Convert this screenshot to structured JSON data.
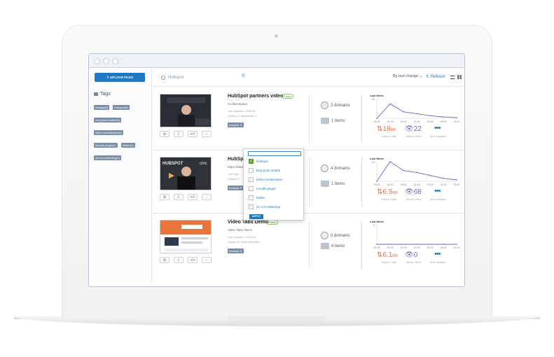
{
  "sidebar": {
    "upload_label": "⇧ UPLOAD FILES",
    "tags_title": "Tags",
    "tags": [
      "metags(0)",
      "hubspot(4)",
      "blog post content(1)",
      "video monetization(1)",
      "moodle plugin(1)",
      "twitter(1)",
      "clc-cnl-marketing(1)"
    ]
  },
  "toolbar": {
    "search_value": "Hubspot",
    "clear_label": "X",
    "sort_label": "By last change ⌄",
    "refresh_label": "↻ Refresh"
  },
  "videos": [
    {
      "title": "HubSpot partners video",
      "status": "Public",
      "description": "no description",
      "updated": "Last Updated: 10/23/18",
      "gallery": "Gallery ID: 8f6t4f4dtut_s",
      "tag": "hubspot ✕",
      "domains": "2 domains",
      "items": "1 items",
      "chart_title": "Last Week",
      "traffic": "18",
      "traffic_unit": "MB",
      "views": "22",
      "traffic_label": "Today's Traffic",
      "views_label": "Weekly Views",
      "more_label": "More Analytics",
      "axis": [
        "05.05",
        "05.05",
        "05.05",
        "05.05",
        "05.05",
        "05.05",
        "05.05"
      ]
    },
    {
      "title": "HubSpot",
      "description": "https://www.",
      "updated": "Last Upd",
      "gallery": "Gallery ID",
      "tag": "hubspot ✕",
      "domains": "4 domains",
      "items": "1 items",
      "chart_title": "Last Week",
      "traffic": "6.5",
      "traffic_unit": "MB",
      "views": "68",
      "traffic_label": "Today's Traffic",
      "views_label": "Weekly Views",
      "more_label": "More Analytics",
      "axis": [
        "05.05",
        "05.05",
        "05.05",
        "05.05",
        "05.05",
        "05.05",
        "05.05"
      ]
    },
    {
      "title": "Video Tabs Demo",
      "status": "Public",
      "description": "Video Tabs Demo",
      "updated": "Last Updated: 10/23/18",
      "gallery": "Gallery ID: 4D6NIHDsdNf4",
      "tag": "hubspot ✕",
      "domains": "0 domains",
      "items": "4 items",
      "chart_title": "Last Week",
      "traffic": "6.1",
      "traffic_unit": "MB",
      "views": "0",
      "traffic_label": "Today's Traffic",
      "views_label": "Weekly Views",
      "more_label": "More Analytics",
      "axis": [
        "05.05",
        "05.05",
        "05.05",
        "05.05",
        "05.05",
        "05.05",
        "05.05"
      ]
    }
  ],
  "dropdown": {
    "items": [
      {
        "label": "Hubspot",
        "checked": true
      },
      {
        "label": "blog post content",
        "checked": false
      },
      {
        "label": "video monetization",
        "checked": false
      },
      {
        "label": "moodle plugin",
        "checked": false
      },
      {
        "label": "twitter",
        "checked": false
      },
      {
        "label": "clc-cnl-marketing",
        "checked": false
      }
    ],
    "apply_label": "APPLY"
  },
  "chart_data": [
    {
      "type": "line",
      "title": "Last Week",
      "x": [
        "05.05",
        "05.05",
        "05.05",
        "05.05",
        "05.05",
        "05.05",
        "05.05"
      ],
      "values": [
        0,
        22,
        10,
        7,
        4,
        2,
        1
      ],
      "ylim": [
        0,
        30
      ]
    },
    {
      "type": "line",
      "title": "Last Week",
      "x": [
        "05.05",
        "05.05",
        "05.05",
        "05.05",
        "05.05",
        "05.05",
        "05.05"
      ],
      "values": [
        0,
        40,
        22,
        18,
        12,
        6,
        3
      ],
      "ylim": [
        0,
        40
      ]
    },
    {
      "type": "line",
      "title": "Last Week",
      "x": [
        "05.05",
        "05.05",
        "05.05",
        "05.05",
        "05.05",
        "05.05",
        "05.05"
      ],
      "values": [
        0,
        0,
        0,
        0,
        0,
        0,
        0
      ],
      "ylim": [
        0,
        8
      ]
    }
  ],
  "colors": {
    "accent": "#1f78c1",
    "traffic": "#e8743b",
    "views": "#7b5fc7",
    "tag": "#7b8ea7"
  }
}
